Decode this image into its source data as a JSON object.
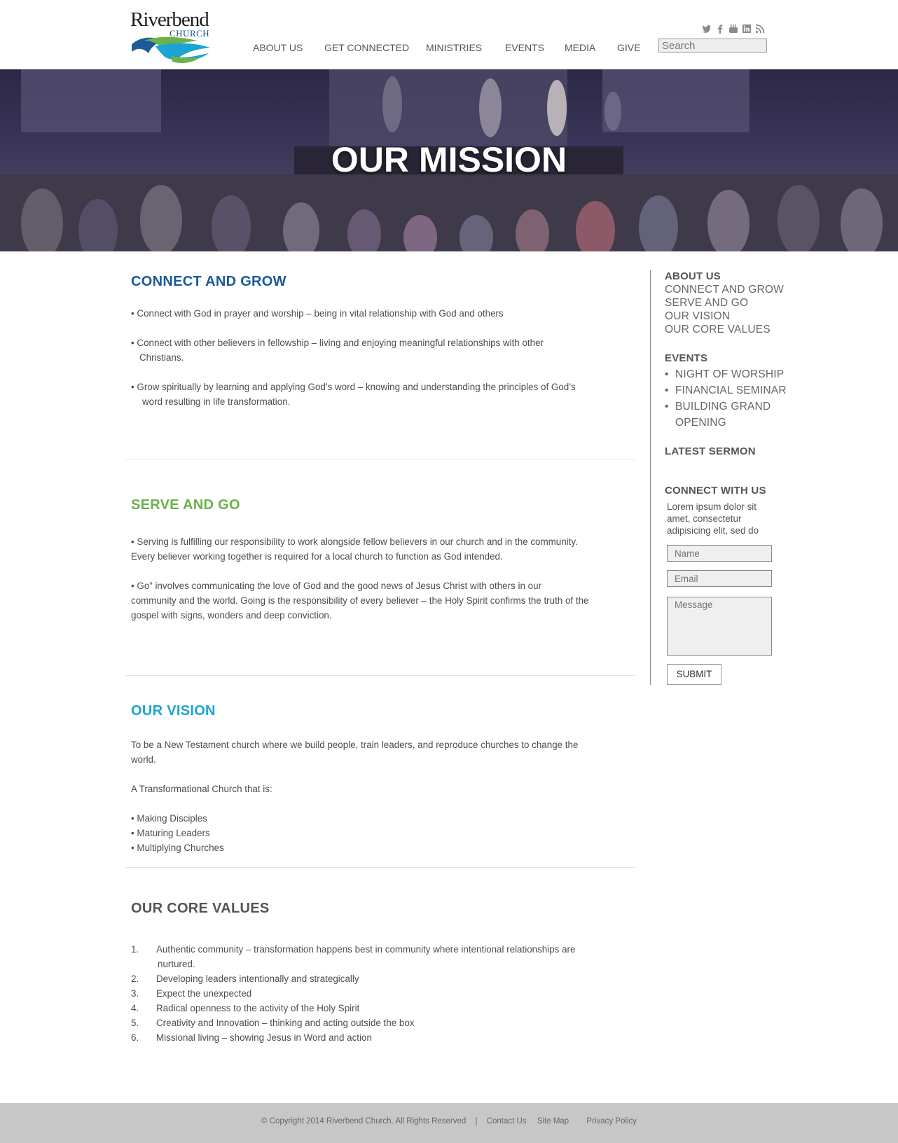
{
  "header": {
    "logo_word": "Riverbend",
    "logo_sub": "CHURCH",
    "nav": [
      "ABOUT US",
      "GET CONNECTED",
      "MINISTRIES",
      "EVENTS",
      "MEDIA",
      "GIVE"
    ],
    "social_icons": [
      "twitter-icon",
      "facebook-icon",
      "youtube-icon",
      "linkedin-icon",
      "rss-icon"
    ],
    "search_placeholder": "Search"
  },
  "hero": {
    "title": "OUR MISSION"
  },
  "sections": {
    "connect": {
      "title": "CONNECT AND GROW",
      "color": "#1c5a99",
      "items": [
        "• Connect with God in prayer and worship – being in vital relationship with God and others",
        "• Connect with other believers in fellowship – living and enjoying meaningful relationships with other",
        "Christians.",
        "• Grow spiritually by learning and applying God’s word – knowing and understanding the principles of God’s",
        "word resulting in life transformation."
      ]
    },
    "serve": {
      "title": "SERVE AND GO",
      "color": "#6bb24a",
      "items": [
        "• Serving is fulfilling our responsibility to work alongside fellow believers in our church and in the community.",
        "Every believer working together is required for a local church to function as God intended.",
        "•  Go” involves communicating the love of God and the good news of Jesus Christ with others in our",
        "community and the world. Going is the responsibility of every believer – the Holy Spirit confirms the truth of the",
        "gospel with signs, wonders and deep conviction."
      ]
    },
    "vision": {
      "title": "OUR VISION",
      "color": "#1aa4d4",
      "line1": "To be a New Testament church where we build people, train leaders, and reproduce churches to change the",
      "line2": "world.",
      "line3": "A Transformational Church that is:",
      "bullets": [
        "• Making Disciples",
        "• Maturing Leaders",
        "• Multiplying Churches"
      ]
    },
    "values": {
      "title": "OUR CORE VALUES",
      "color": "#555555",
      "items": [
        {
          "num": "1.",
          "text": "Authentic community – transformation happens best in community where intentional relationships are",
          "cont": "nurtured."
        },
        {
          "num": "2.",
          "text": "Developing leaders intentionally and strategically"
        },
        {
          "num": "3.",
          "text": "Expect the unexpected"
        },
        {
          "num": "4.",
          "text": "Radical openness to the activity of the Holy Spirit"
        },
        {
          "num": "5.",
          "text": "Creativity and Innovation – thinking and acting outside the box"
        },
        {
          "num": "6.",
          "text": "Missional living – showing Jesus in Word and action"
        }
      ]
    }
  },
  "sidebar": {
    "about_heading": "ABOUT US",
    "about_links": [
      "CONNECT AND GROW",
      "SERVE AND GO",
      "OUR VISION",
      "OUR CORE VALUES"
    ],
    "events_heading": "EVENTS",
    "events": [
      "NIGHT OF WORSHIP",
      "FINANCIAL SEMINAR",
      "BUILDING GRAND",
      "OPENING"
    ],
    "sermon_heading": "LATEST SERMON",
    "connect_heading": "CONNECT WITH US",
    "connect_text": [
      "Lorem ipsum dolor sit",
      "amet, consectetur",
      "adipisicing elit, sed do"
    ],
    "name_placeholder": "Name",
    "email_placeholder": "Email",
    "message_placeholder": "Message",
    "submit_label": "SUBMIT"
  },
  "footer": {
    "copyright": "© Copyright 2014 Riverbend Church. All Rights Reserved",
    "separator": "|",
    "links": [
      "Contact Us",
      "Site Map",
      "Privacy Policy"
    ]
  }
}
